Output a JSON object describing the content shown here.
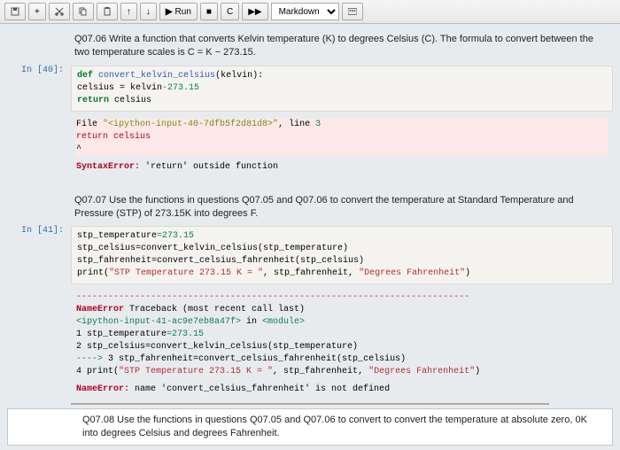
{
  "toolbar": {
    "save_icon": "save",
    "plus_icon": "+",
    "cut_icon": "cut",
    "copy_icon": "copy",
    "paste_icon": "paste",
    "up_icon": "↑",
    "down_icon": "↓",
    "run_label": "Run",
    "stop_icon": "■",
    "restart_icon": "C",
    "ff_icon": "▶▶",
    "cell_type": "Markdown",
    "cmd_icon": "cmd"
  },
  "cells": {
    "q0706": "Q07.06 Write a function that converts Kelvin temperature (K) to degrees Celsius (C). The formula to convert between the two temperature scales is C = K − 273.15.",
    "in40_label": "In [40]:",
    "in40_def": "def",
    "in40_fn": "convert_kelvin_celsius",
    "in40_arg": "(kelvin):",
    "in40_l2a": "    celsius ",
    "in40_l2b": "=",
    "in40_l2c": " kelvin",
    "in40_l2d": "-273.15",
    "in40_ret": "return",
    "in40_retv": " celsius",
    "out40_file": "File ",
    "out40_fname": "\"<ipython-input-40-7dfb5f2d81d8>\"",
    "out40_line": ", line ",
    "out40_lineno": "3",
    "out40_ret": "    return celsius",
    "out40_caret": "           ^",
    "out40_err": "SyntaxError:",
    "out40_msg": " 'return' outside function",
    "q0707": "Q07.07 Use the functions in questions Q07.05 and Q07.06 to convert the temperature at Standard Temperature and Pressure (STP) of 273.15K into degrees F.",
    "in41_label": "In [41]:",
    "in41_l1a": "stp_temperature",
    "in41_l1b": "=273.15",
    "in41_l2": "stp_celsius=convert_kelvin_celsius(stp_temperature)",
    "in41_l3": "stp_fahrenheit=convert_celsius_fahrenheit(stp_celsius)",
    "in41_l4a": "print(",
    "in41_l4b": "\"STP Temperature 273.15 K = \"",
    "in41_l4c": ", stp_fahrenheit, ",
    "in41_l4d": "\"Degrees Fahrenheit\"",
    "in41_l4e": ")",
    "out41_dash": "--------------------------------------------------------------------------",
    "out41_err": "NameError",
    "out41_tb": "                               Traceback (most recent call last)",
    "out41_f1a": "<ipython-input-41-ac9e7eb8a47f>",
    "out41_f1b": " in ",
    "out41_f1c": "<module>",
    "out41_t1a": "      1 stp_temperature",
    "out41_t1b": "=273.15",
    "out41_t2": "      2 stp_celsius=convert_kelvin_celsius(stp_temperature)",
    "out41_arrow": "----> ",
    "out41_t3": "3 stp_fahrenheit=convert_celsius_fahrenheit(stp_celsius)",
    "out41_t4a": "      4 print(",
    "out41_t4b": "\"STP Temperature 273.15 K = \"",
    "out41_t4c": ", stp_fahrenheit, ",
    "out41_t4d": "\"Degrees Fahrenheit\"",
    "out41_t4e": ")",
    "out41_nerr": "NameError:",
    "out41_nmsg": " name 'convert_celsius_fahrenheit' is not defined",
    "q0708": "Q07.08 Use the functions in questions Q07.05 and Q07.06 to convert to convert the temperature at absolute zero, 0K into degrees Celsius and degrees Fahrenheit."
  }
}
